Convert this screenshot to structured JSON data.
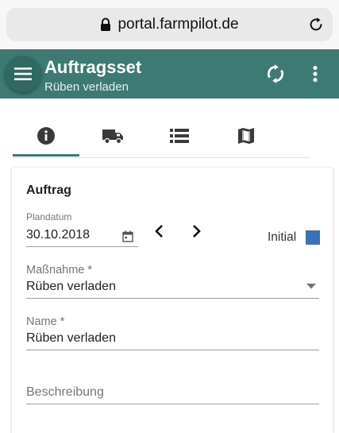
{
  "browser": {
    "url": "portal.farmpilot.de",
    "icons": {
      "lock": "lock-icon",
      "reload": "reload-icon"
    }
  },
  "app_bar": {
    "title": "Auftragsset",
    "subtitle": "Rüben verladen",
    "color": "#3d7a73",
    "icons": {
      "menu": "menu-icon",
      "sync": "sync-icon",
      "more": "more-vert-icon"
    }
  },
  "tabs": [
    {
      "icon": "info-icon",
      "active": true
    },
    {
      "icon": "truck-icon",
      "active": false
    },
    {
      "icon": "list-icon",
      "active": false
    },
    {
      "icon": "map-icon",
      "active": false
    }
  ],
  "form": {
    "section_title": "Auftrag",
    "plandatum": {
      "label": "Plandatum",
      "value": "30.10.2018"
    },
    "initial": {
      "label": "Initial",
      "color": "#3b6fb6"
    },
    "massnahme": {
      "label": "Maßnahme *",
      "value": "Rüben verladen"
    },
    "name": {
      "label": "Name *",
      "value": "Rüben verladen"
    },
    "beschreibung": {
      "placeholder": "Beschreibung"
    }
  }
}
